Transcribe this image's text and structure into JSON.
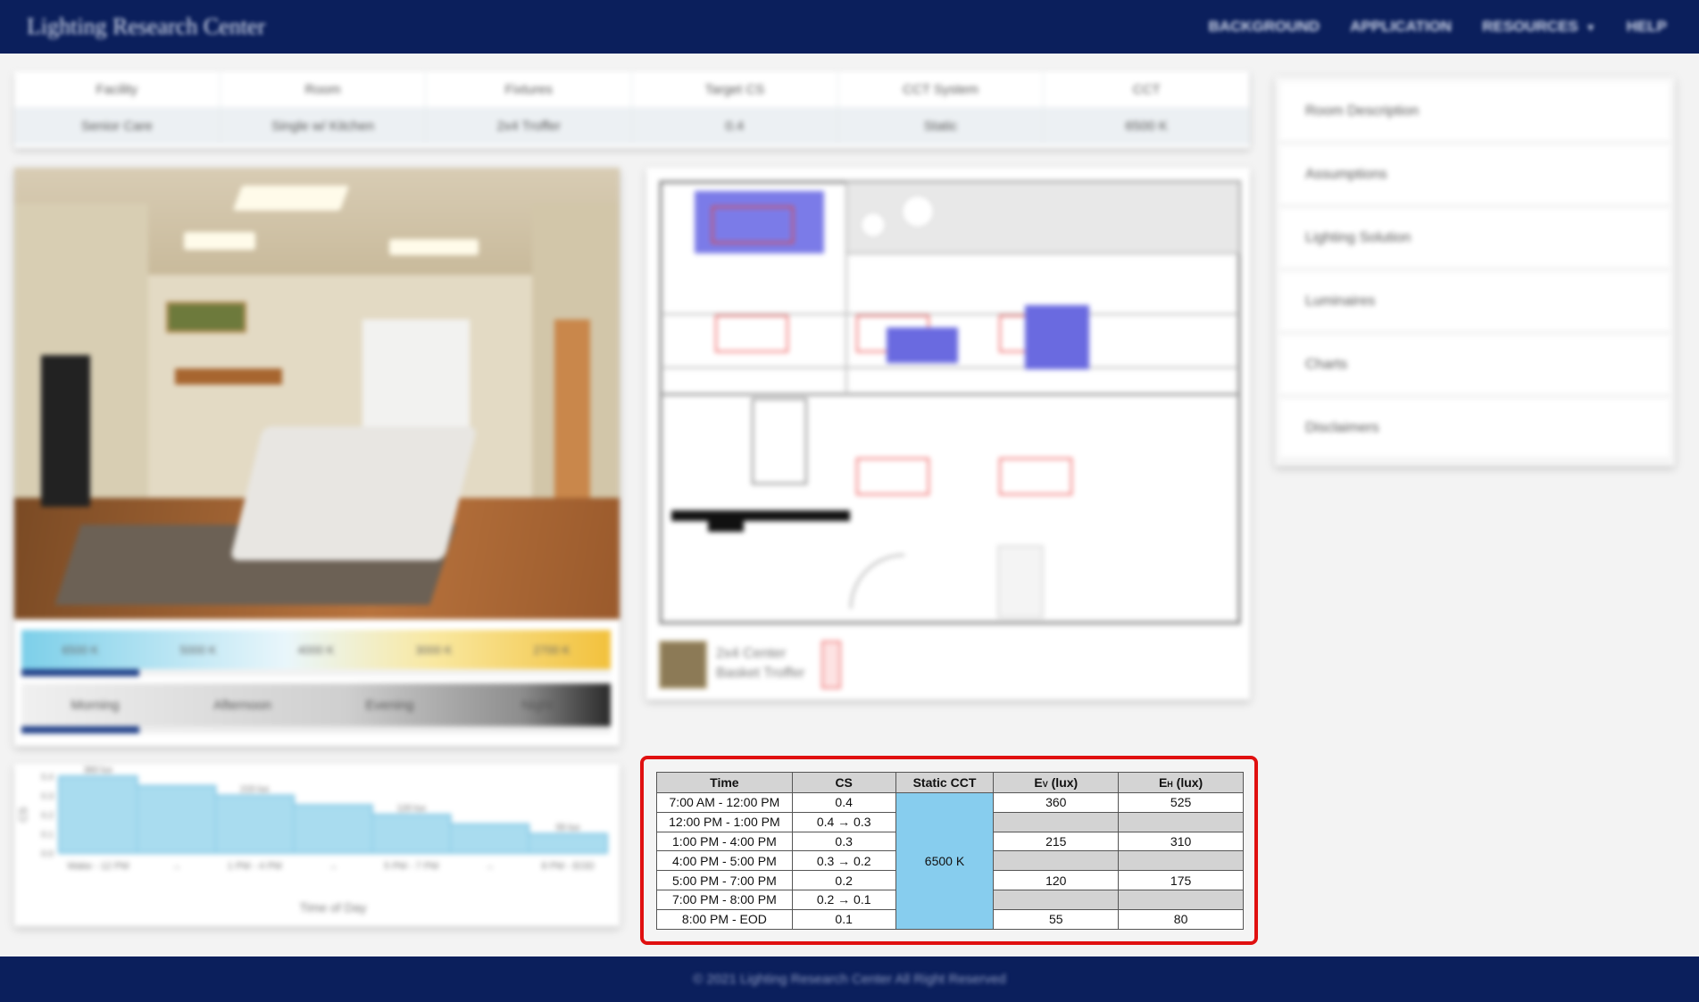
{
  "header": {
    "brand": "Lighting Research Center",
    "nav": [
      "BACKGROUND",
      "APPLICATION",
      "RESOURCES",
      "HELP"
    ]
  },
  "info_strip": {
    "headers": [
      "Facility",
      "Room",
      "Fixtures",
      "Target CS",
      "CCT System",
      "CCT"
    ],
    "values": [
      "Senior Care",
      "Single w/ Kitchen",
      "2x4 Troffer",
      "0.4",
      "Static",
      "6500 K"
    ]
  },
  "right_panel": {
    "items": [
      "Room Description",
      "Assumptions",
      "Lighting Solution",
      "Luminaires",
      "Charts",
      "Disclaimers"
    ]
  },
  "cct_selector": {
    "labels": [
      "6500 K",
      "5000 K",
      "4000 K",
      "3000 K",
      "2700 K"
    ],
    "progress_fraction": 0.2
  },
  "time_of_day": {
    "labels": [
      "Morning",
      "Afternoon",
      "Evening",
      "Night"
    ],
    "progress_fraction": 0.2
  },
  "luminaire_legend": {
    "line1": "2x4 Center",
    "line2": "Basket Troffer"
  },
  "chart": {
    "xlabel": "Time of Day",
    "ylabel": "CS",
    "y_ticks": [
      "0.4",
      "0.3",
      "0.2",
      "0.1",
      "0.0"
    ],
    "x_ticks": [
      "Wake - 12 PM",
      "→",
      "1 PM - 4 PM",
      "→",
      "5 PM - 7 PM",
      "→",
      "8 PM - EOD"
    ],
    "annotations": [
      "360 lux",
      "215 lux",
      "120 lux",
      "55 lux"
    ]
  },
  "chart_data": {
    "type": "area",
    "x": [
      "Wake - 12 PM",
      "12 PM - 1 PM",
      "1 PM - 4 PM",
      "4 PM - 5 PM",
      "5 PM - 7 PM",
      "7 PM - 8 PM",
      "8 PM - EOD"
    ],
    "values": [
      0.4,
      0.35,
      0.3,
      0.25,
      0.2,
      0.15,
      0.1
    ],
    "xlabel": "Time of Day",
    "ylabel": "CS",
    "ylim": [
      0,
      0.4
    ],
    "annotations": [
      "360 lux",
      "215 lux",
      "120 lux",
      "55 lux"
    ]
  },
  "schedule": {
    "headers": {
      "time": "Time",
      "cs": "CS",
      "cct": "Static CCT",
      "ev_main": "E",
      "ev_sub": "V",
      "ev_unit": " (lux)",
      "eh_main": "E",
      "eh_sub": "H",
      "eh_unit": " (lux)"
    },
    "static_cct": "6500 K",
    "rows": [
      {
        "time": "7:00 AM - 12:00 PM",
        "cs": "0.4",
        "ev": "360",
        "eh": "525"
      },
      {
        "time": "12:00 PM - 1:00 PM",
        "cs": "0.4 → 0.3",
        "ev": "",
        "eh": ""
      },
      {
        "time": "1:00 PM - 4:00 PM",
        "cs": "0.3",
        "ev": "215",
        "eh": "310"
      },
      {
        "time": "4:00 PM - 5:00 PM",
        "cs": "0.3 → 0.2",
        "ev": "",
        "eh": ""
      },
      {
        "time": "5:00 PM - 7:00 PM",
        "cs": "0.2",
        "ev": "120",
        "eh": "175"
      },
      {
        "time": "7:00 PM - 8:00 PM",
        "cs": "0.2 → 0.1",
        "ev": "",
        "eh": ""
      },
      {
        "time": "8:00 PM - EOD",
        "cs": "0.1",
        "ev": "55",
        "eh": "80"
      }
    ]
  },
  "footer": {
    "text": "© 2021 Lighting Research Center All Right Reserved"
  }
}
